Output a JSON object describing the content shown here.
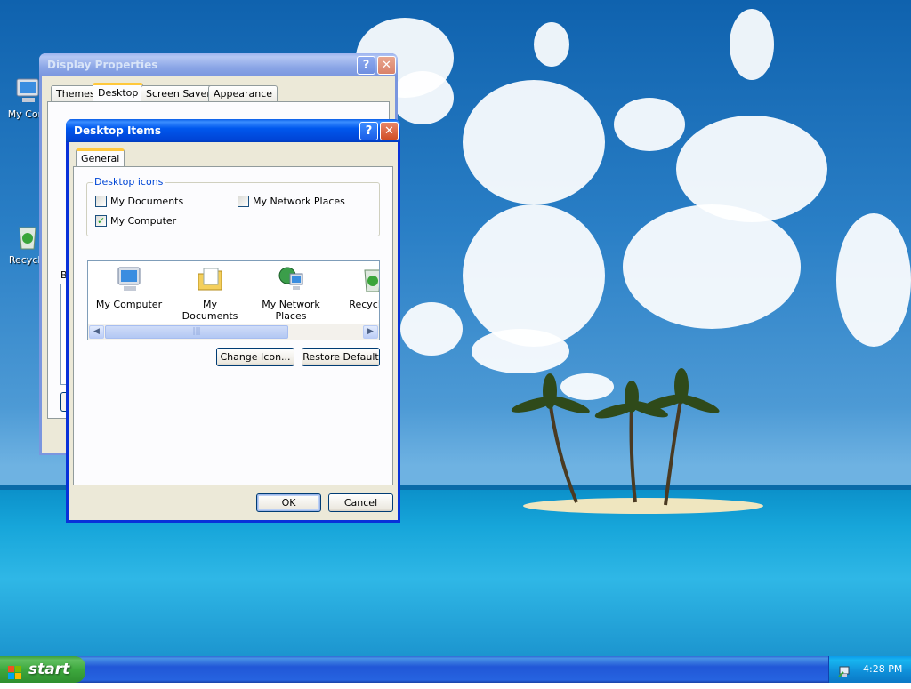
{
  "desktop": {
    "icons": [
      {
        "label": "My Com",
        "icon": "my-computer-icon"
      },
      {
        "label": "Recycle",
        "icon": "recycle-bin-icon"
      }
    ]
  },
  "display_properties": {
    "title": "Display Properties",
    "tabs": [
      "Themes",
      "Desktop",
      "Screen Saver",
      "Appearance"
    ],
    "selected_tab": "Desktop",
    "partial_label": "B"
  },
  "desktop_items": {
    "title": "Desktop Items",
    "tab": "General",
    "group_title": "Desktop icons",
    "checkboxes": [
      {
        "label": "My Documents",
        "checked": false
      },
      {
        "label": "My Network Places",
        "checked": false
      },
      {
        "label": "My Computer",
        "checked": true
      }
    ],
    "icon_items": [
      {
        "label": "My Computer",
        "icon": "my-computer-icon"
      },
      {
        "label": "My Documents",
        "icon": "my-documents-icon"
      },
      {
        "label": "My Network Places",
        "icon": "network-places-icon"
      },
      {
        "label": "Recycle B",
        "icon": "recycle-bin-icon"
      }
    ],
    "change_icon_label": "Change Icon...",
    "restore_default_label": "Restore Default",
    "ok_label": "OK",
    "cancel_label": "Cancel"
  },
  "taskbar": {
    "start_label": "start",
    "clock": "4:28 PM"
  },
  "colors": {
    "title_active": "#0058ee",
    "title_inactive": "#7a96df",
    "dialog_face": "#ece9d8",
    "start_green": "#3ea83e",
    "tray_blue": "#0f8ed8"
  }
}
